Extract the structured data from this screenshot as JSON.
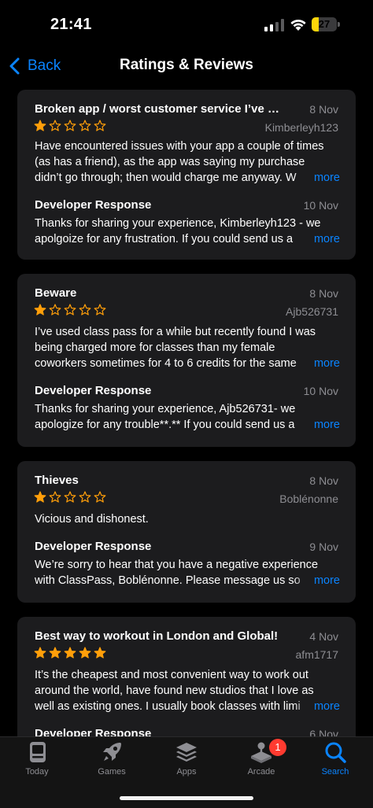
{
  "status_bar": {
    "time": "21:41",
    "battery_level": "27",
    "battery_fraction": 0.27,
    "icons": [
      "signal-icon",
      "wifi-icon",
      "battery-icon"
    ]
  },
  "nav": {
    "back_label": "Back",
    "title": "Ratings & Reviews"
  },
  "colors": {
    "accent": "#0a84ff",
    "star": "#ff9f0a",
    "card": "#1c1c1e",
    "secondary_text": "#8e8e93"
  },
  "reviews": [
    {
      "title": "Broken app / worst customer service I’ve ever...",
      "date": "8 Nov",
      "author": "Kimberleyh123",
      "rating": 1,
      "body_lines": [
        "Have encountered issues with your app a couple of times",
        "(as has a friend), as the app was saying my purchase",
        "didn’t go through; then would charge me anyway. W"
      ],
      "more_label": "more",
      "developer_response": {
        "title": "Developer Response",
        "date": "10 Nov",
        "lines": [
          "Thanks for sharing your experience, Kimberleyh123 - we",
          "apolgoize for any frustration. If you could send us a"
        ],
        "more_label": "more"
      }
    },
    {
      "title": "Beware",
      "date": "8 Nov",
      "author": "Ajb526731",
      "rating": 1,
      "body_lines": [
        "I’ve used class pass for a while but recently found I was",
        "being charged more for classes than my female",
        "coworkers sometimes for 4 to 6 credits for the same"
      ],
      "more_label": "more",
      "developer_response": {
        "title": "Developer Response",
        "date": "10 Nov",
        "lines": [
          "Thanks for sharing your experience, Ajb526731- we",
          "apologize for any trouble**.** If you could send us a"
        ],
        "more_label": "more"
      }
    },
    {
      "title": "Thieves",
      "date": "8 Nov",
      "author": "Boblénonne",
      "rating": 1,
      "body_lines": [
        "Vicious and dishonest."
      ],
      "developer_response": {
        "title": "Developer Response",
        "date": "9 Nov",
        "lines": [
          "We’re sorry to hear that you have a negative experience",
          "with ClassPass, Boblénonne. Please message us so"
        ],
        "more_label": "more"
      }
    },
    {
      "title": "Best way to workout in London and Global!",
      "date": "4 Nov",
      "author": "afm1717",
      "rating": 5,
      "body_lines": [
        "It’s the cheapest and most convenient way to work out",
        "around the world, have found new studios that I love as",
        "well as existing ones. I usually book classes with limi"
      ],
      "more_label": "more",
      "developer_response": {
        "title": "Developer Response",
        "date": "6 Nov",
        "lines": [],
        "more_label": ""
      }
    }
  ],
  "tab_bar": {
    "tabs": [
      {
        "label": "Today",
        "icon": "today-icon"
      },
      {
        "label": "Games",
        "icon": "rocket-icon"
      },
      {
        "label": "Apps",
        "icon": "apps-stack-icon"
      },
      {
        "label": "Arcade",
        "icon": "arcade-joystick-icon"
      },
      {
        "label": "Search",
        "icon": "search-icon"
      }
    ],
    "active": "Search",
    "arcade_badge": "1"
  }
}
